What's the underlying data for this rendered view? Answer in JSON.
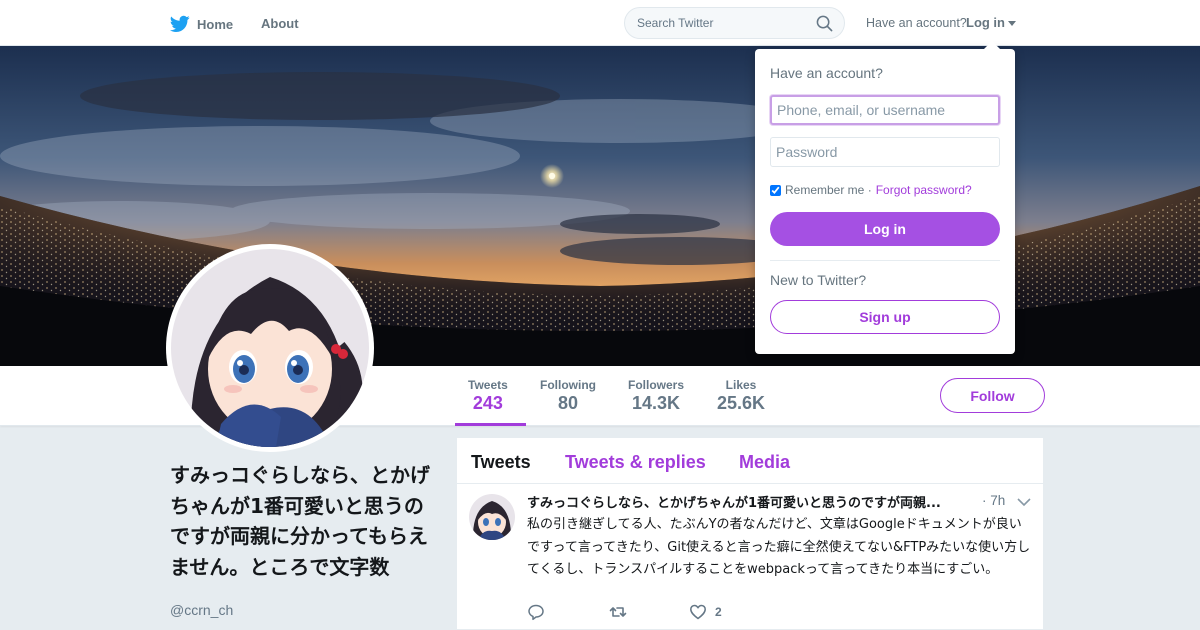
{
  "nav": {
    "home_label": "Home",
    "about_label": "About",
    "search_placeholder": "Search Twitter",
    "have_account": "Have an account?",
    "login_label": "Log in"
  },
  "profile": {
    "name": "すみっコぐらしなら、とかげちゃんが1番可愛いと思うのですが両親に分かってもらえません。ところで文字数",
    "handle": "@ccrn_ch",
    "follow_label": "Follow",
    "stats": [
      {
        "label": "Tweets",
        "value": "243"
      },
      {
        "label": "Following",
        "value": "80"
      },
      {
        "label": "Followers",
        "value": "14.3K"
      },
      {
        "label": "Likes",
        "value": "25.6K"
      }
    ]
  },
  "timeline": {
    "tabs": [
      "Tweets",
      "Tweets & replies",
      "Media"
    ],
    "tweet": {
      "name": "すみっコぐらしなら、とかげちゃんが1番可愛いと思うのですが両親...",
      "time": "· 7h",
      "text": "私の引き継ぎしてる人、たぶんYの者なんだけど、文章はGoogleドキュメントが良いですって言ってきたり、Git使えると言った癖に全然使えてない&FTPみたいな使い方してくるし、トランスパイルすることをwebpackって言ってきたり本当にすごい。",
      "likes": "2"
    }
  },
  "login_dropdown": {
    "title": "Have an account?",
    "username_placeholder": "Phone, email, or username",
    "password_placeholder": "Password",
    "remember_label": "Remember me ·",
    "forgot_label": "Forgot password?",
    "login_button": "Log in",
    "new_label": "New to Twitter?",
    "signup_button": "Sign up"
  },
  "icons": {
    "logo": "twitter-bird-icon",
    "search": "search-icon",
    "caret": "caret-down-icon",
    "reply": "reply-icon",
    "retweet": "retweet-icon",
    "like": "heart-icon",
    "chevron": "chevron-down-icon"
  },
  "colors": {
    "accent": "#a23cdb",
    "twitter_blue": "#1da1f2",
    "muted": "#657786"
  }
}
